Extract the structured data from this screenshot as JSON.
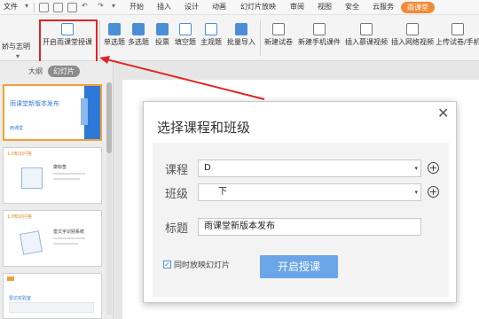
{
  "menubar": {
    "file": "文件",
    "start": "开始",
    "insert": "插入",
    "design": "设计",
    "animation": "动画",
    "slideshow": "幻灯片放映",
    "review": "审阅",
    "view": "视图",
    "security": "安全",
    "cloud": "云服务",
    "rainclass": "雨课堂"
  },
  "ribbon": {
    "left_label": "娇与志明",
    "open_classroom": "开启雨课堂授课",
    "single_choice": "单选题",
    "multi_choice": "多选题",
    "vote": "投票",
    "fill_blank": "填空题",
    "subjective": "主观题",
    "batch_import": "批量导入",
    "new_paper": "新建试卷",
    "new_mobile": "新建手机课件",
    "insert_mooc": "插入慕课视频",
    "insert_web": "插入网络视频",
    "upload": "上传试卷/手机"
  },
  "leftpane": {
    "tab_outline": "大纲",
    "tab_slides": "幻灯片",
    "thumb1_title": "雨课堂新版本发布",
    "thumb1_logo": "雨课堂",
    "thumb2_tag": "1.0知识问答",
    "thumb2_head": "做标签",
    "thumb3_tag": "1.0知识问答",
    "thumb3_head": "雷文字识别系统",
    "thumb4_head": "雷达实验室"
  },
  "dialog": {
    "title": "选择课程和班级",
    "course_label": "课程",
    "course_value": "D",
    "class_label": "班级",
    "class_value": "下",
    "name_label": "标题",
    "name_value": "雨课堂新版本发布",
    "sync_label": "同时放映幻灯片",
    "sync_checked": "✓",
    "start_button": "开启授课",
    "close": "✕"
  },
  "colors": {
    "accent": "#f08a36",
    "highlight": "#e02424",
    "button_blue": "#6aa6e8"
  }
}
